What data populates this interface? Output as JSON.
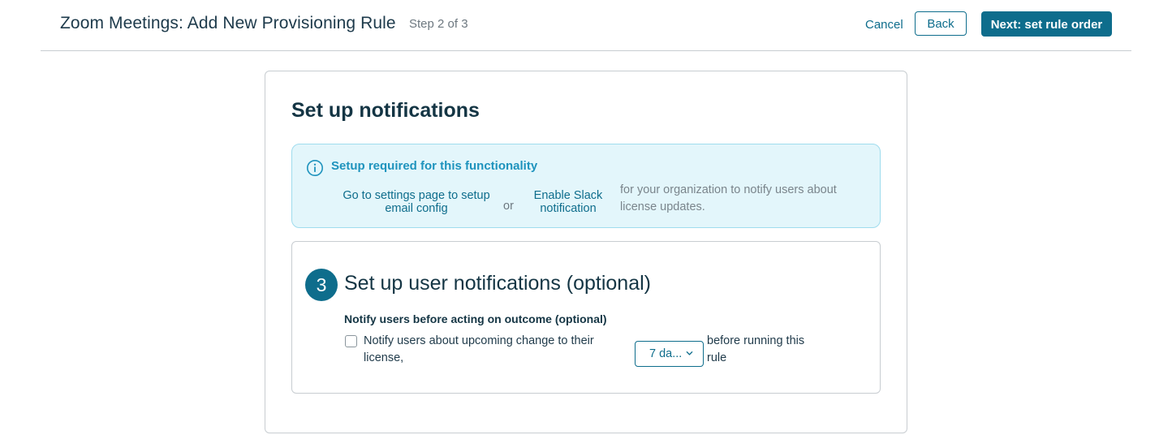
{
  "header": {
    "title": "Zoom Meetings: Add New Provisioning Rule",
    "step": "Step 2 of 3",
    "cancel_label": "Cancel",
    "back_label": "Back",
    "next_label": "Next: set rule order"
  },
  "card": {
    "title": "Set up notifications",
    "info": {
      "icon": "info-icon",
      "title": "Setup required for this functionality",
      "settings_link": "Go to settings page to setup email config",
      "or": "or",
      "slack_link": "Enable Slack notification",
      "description": "for your organization to notify users about license updates."
    },
    "section": {
      "step_number": "3",
      "title": "Set up user notifications (optional)",
      "notify_heading": "Notify users before acting on outcome (optional)",
      "checkbox_label": "Notify users about upcoming change to their license,",
      "checkbox_checked": false,
      "days_value": "7 da...",
      "after_text": "before running this rule"
    }
  },
  "colors": {
    "accent": "#0e6d8c",
    "info_bg": "#e3f6fb",
    "info_border": "#9fdcee",
    "info_title": "#1e93bd",
    "title_text": "#143544"
  }
}
